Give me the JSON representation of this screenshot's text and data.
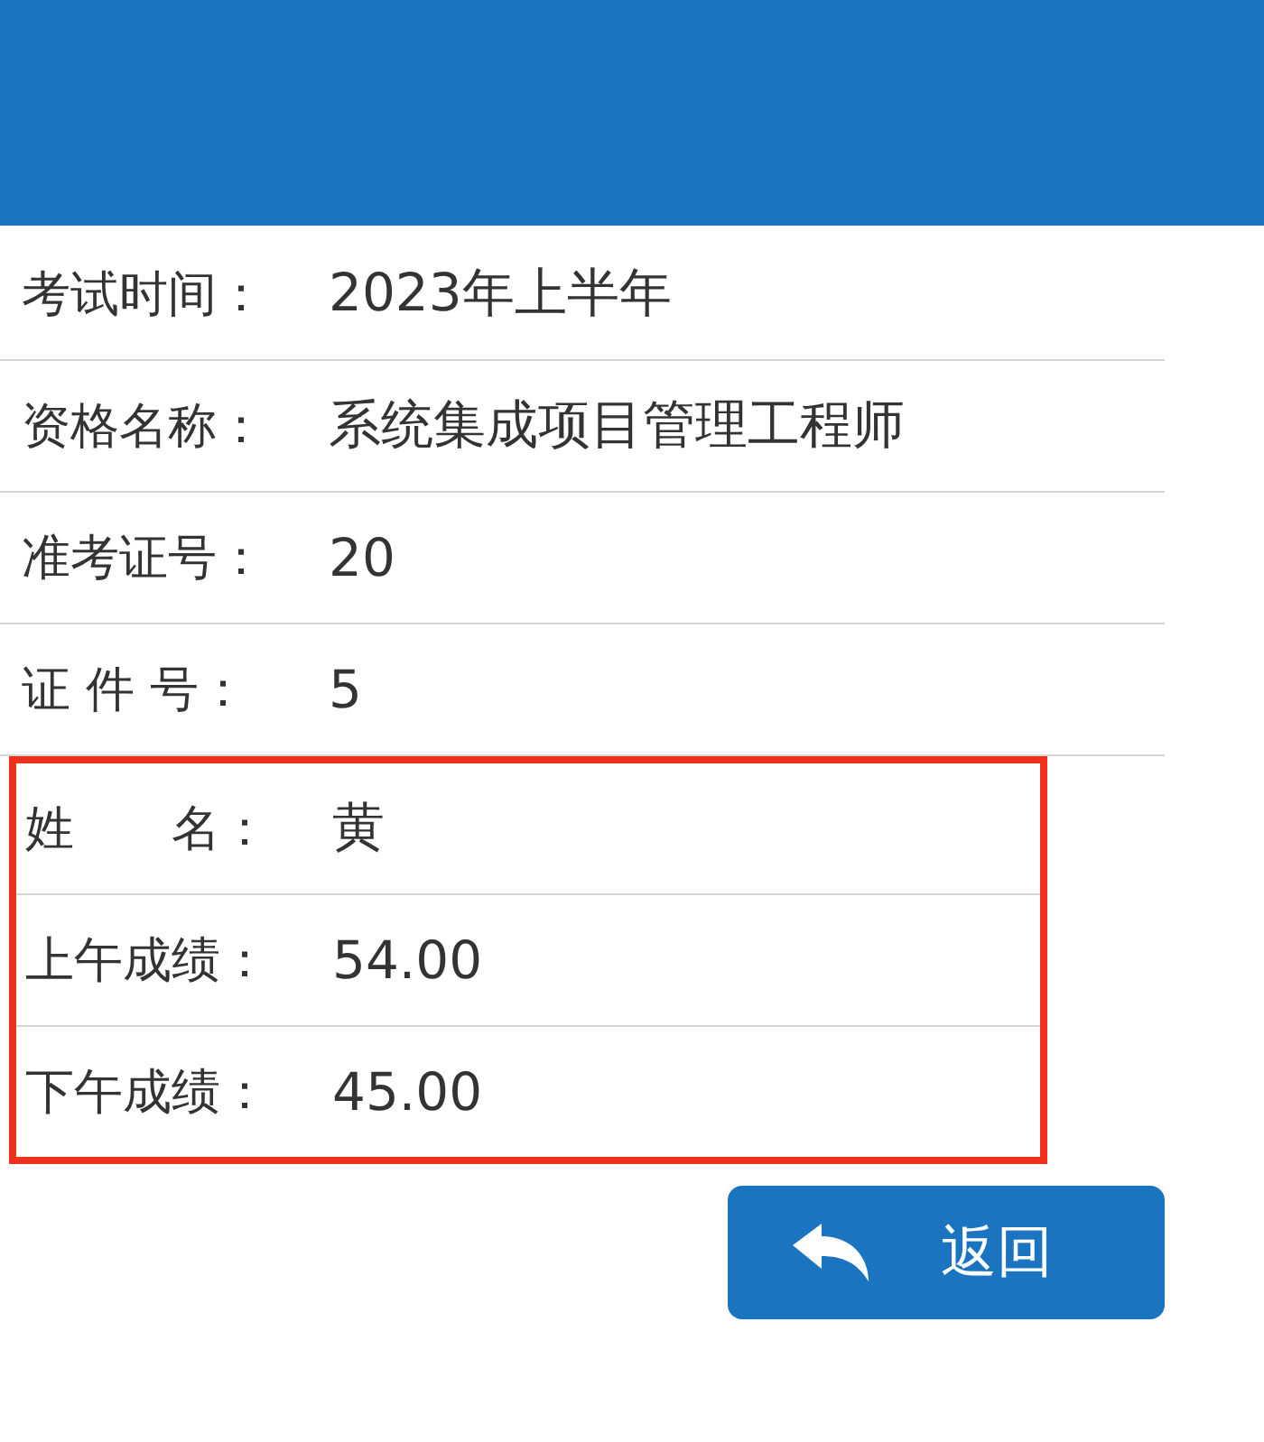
{
  "rows": [
    {
      "label": "考试时间：",
      "value": "2023年上半年"
    },
    {
      "label": "资格名称：",
      "value": "系统集成项目管理工程师"
    },
    {
      "label": "准考证号：",
      "value": "20"
    },
    {
      "label": "证 件 号：",
      "value": "5"
    }
  ],
  "highlight_frame": {
    "rows": [
      {
        "label": "姓　　名：",
        "value": "黄"
      },
      {
        "label": "上午成绩：",
        "value": "54.00"
      },
      {
        "label": "下午成绩：",
        "value": "45.00"
      }
    ]
  },
  "back_button": {
    "label": "返回"
  }
}
